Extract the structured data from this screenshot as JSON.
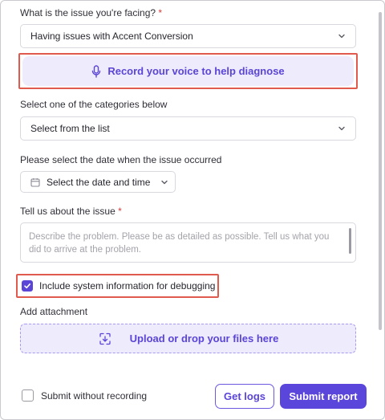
{
  "form": {
    "issue_label": "What is the issue you're facing?",
    "required_mark": "*",
    "issue_value": "Having issues with Accent Conversion",
    "voice_button_label": "Record your voice to help diagnose",
    "category_label": "Select one of the categories below",
    "category_value": "Select from the list",
    "date_label": "Please select the date when the issue occurred",
    "date_button_label": "Select the date and time",
    "details_label": "Tell us about the issue",
    "details_placeholder": "Describe the problem. Please be as detailed as possible. Tell us what you did to arrive at the problem.",
    "include_sysinfo_label": "Include system information for debugging",
    "include_sysinfo_checked": true,
    "attachment_label": "Add attachment",
    "upload_label": "Upload or drop your files here"
  },
  "footer": {
    "submit_without_recording_label": "Submit without recording",
    "submit_without_recording_checked": false,
    "get_logs_label": "Get logs",
    "submit_label": "Submit report"
  },
  "colors": {
    "accent": "#5b46db",
    "accent_light": "#eeebfd",
    "highlight": "#e05a4e",
    "required": "#d93a3a"
  },
  "icons": {
    "voice": "microphone-icon",
    "date": "calendar-icon",
    "upload": "upload-file-icon",
    "dropdown": "chevron-down-icon",
    "check": "check-icon"
  }
}
